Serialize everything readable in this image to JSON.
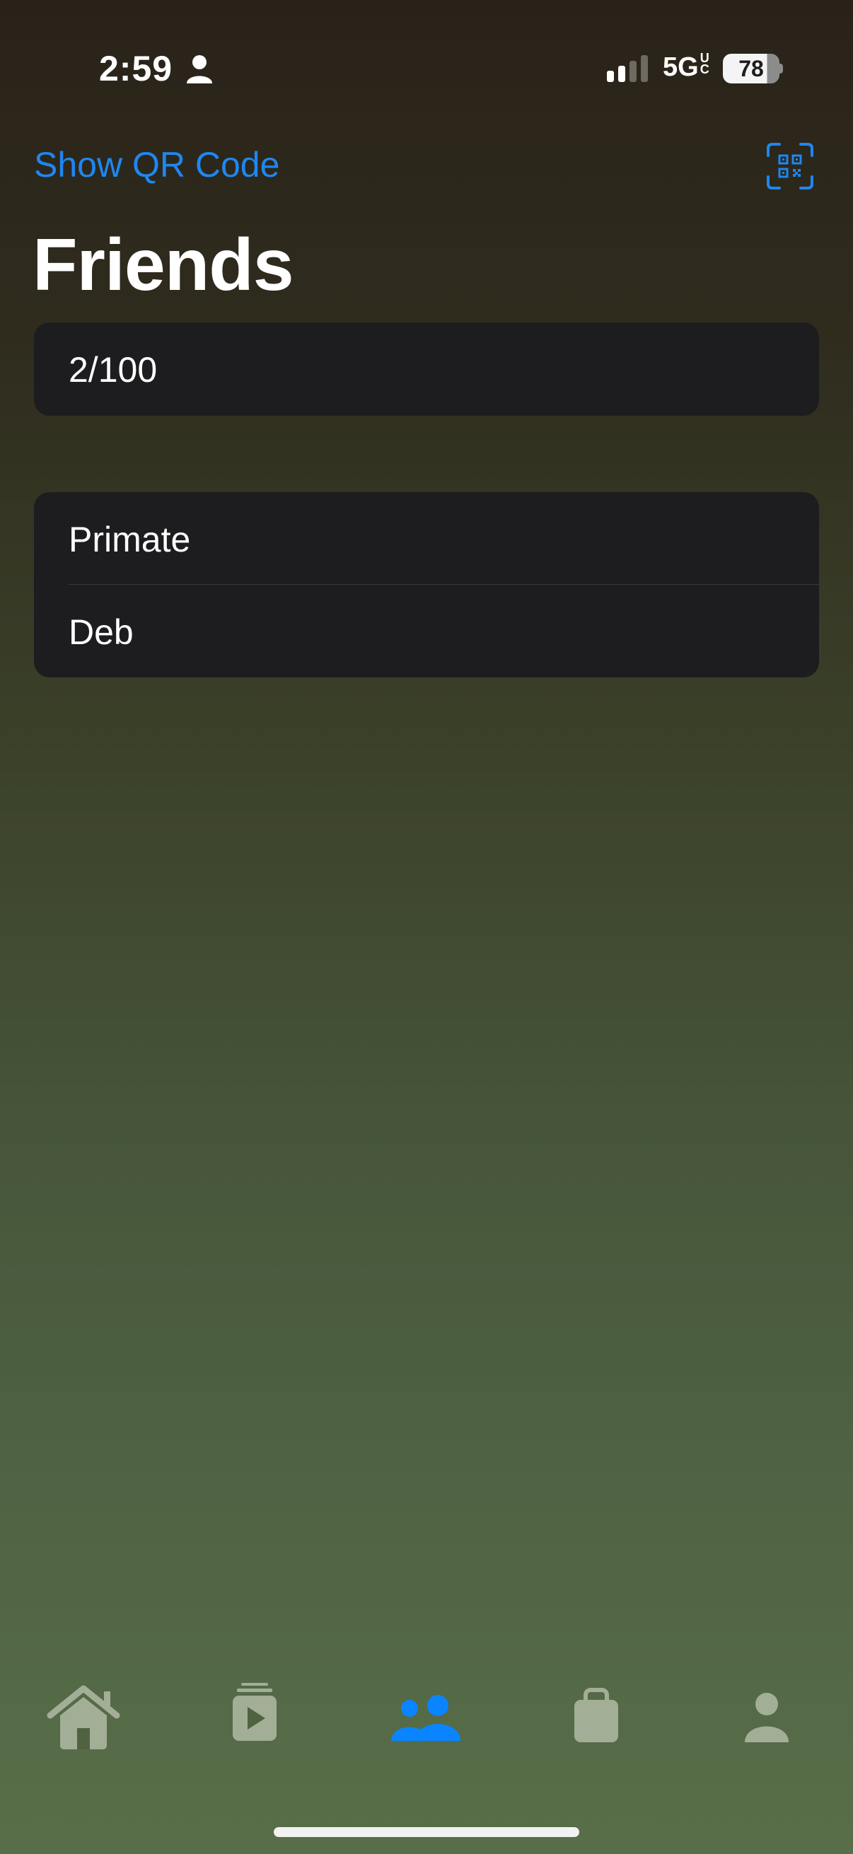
{
  "status_bar": {
    "time": "2:59",
    "network": "5G",
    "network_sup_top": "U",
    "network_sup_bottom": "C",
    "battery": "78"
  },
  "nav": {
    "show_qr_label": "Show QR Code",
    "scan_icon": "qr-scan-icon"
  },
  "page": {
    "title": "Friends",
    "count": "2/100"
  },
  "friends": [
    {
      "name": "Primate"
    },
    {
      "name": "Deb"
    }
  ],
  "tab_bar": {
    "tabs": [
      {
        "icon": "home-icon",
        "active": false
      },
      {
        "icon": "media-stack-icon",
        "active": false
      },
      {
        "icon": "friends-icon",
        "active": true
      },
      {
        "icon": "shopping-bag-icon",
        "active": false
      },
      {
        "icon": "person-icon",
        "active": false
      }
    ],
    "active_color": "#0a84ff",
    "inactive_color": "#a3ae96"
  },
  "colors": {
    "accent": "#1e87f0",
    "card": "#1d1d1f"
  }
}
